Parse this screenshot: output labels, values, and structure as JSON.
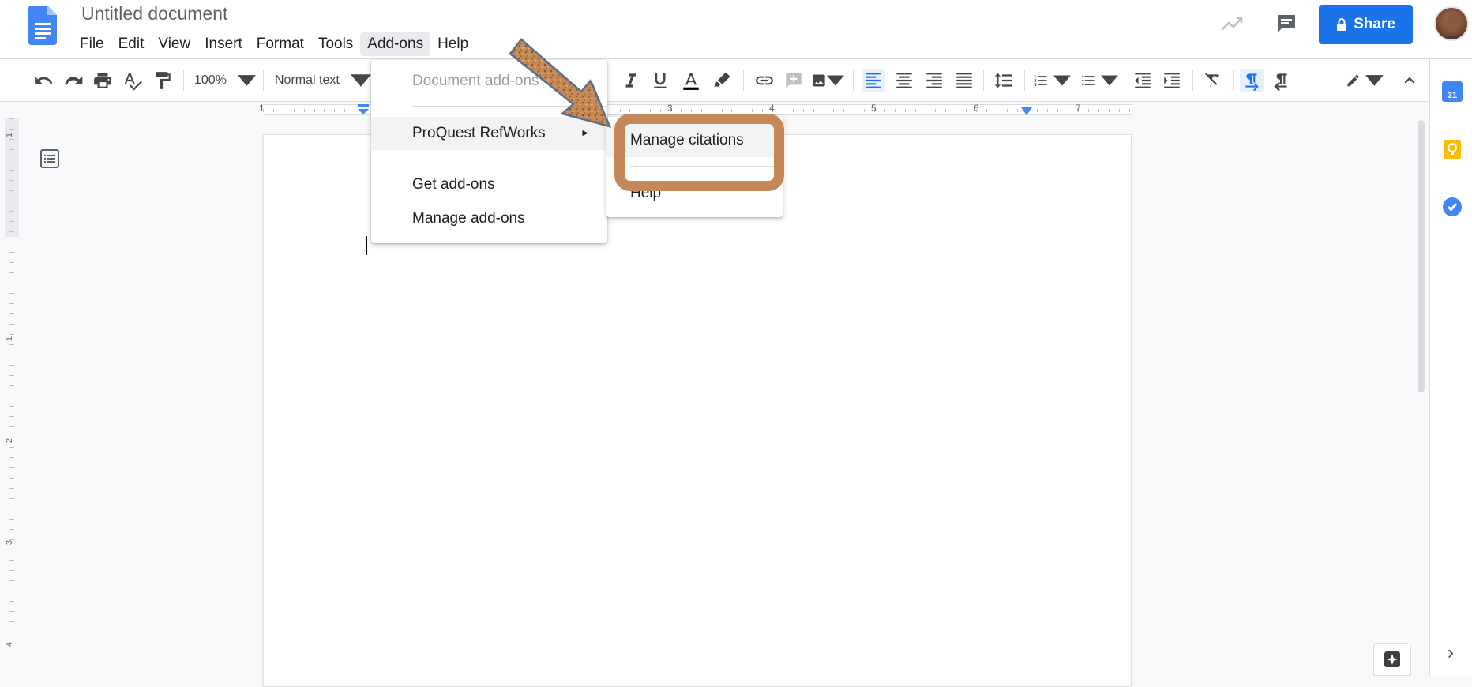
{
  "header": {
    "title": "Untitled document",
    "menus": [
      "File",
      "Edit",
      "View",
      "Insert",
      "Format",
      "Tools",
      "Add-ons",
      "Help"
    ],
    "active_menu": "Add-ons",
    "share_label": "Share",
    "brand_color": "#1a73e8"
  },
  "toolbar": {
    "zoom": "100%",
    "style": "Normal text",
    "icons": [
      "undo-icon",
      "redo-icon",
      "print-icon",
      "spellcheck-icon",
      "paint-format-icon",
      "italic-icon",
      "underline-icon",
      "text-color-icon",
      "highlight-icon",
      "link-icon",
      "comment-icon",
      "image-icon",
      "align-left-icon",
      "align-center-icon",
      "align-right-icon",
      "justify-icon",
      "line-spacing-icon",
      "numbered-list-icon",
      "bulleted-list-icon",
      "decrease-indent-icon",
      "increase-indent-icon",
      "clear-formatting-icon",
      "ltr-icon",
      "rtl-icon",
      "editing-mode-icon",
      "collapse-icon"
    ]
  },
  "ruler": {
    "numbers": [
      "1",
      "3",
      "4",
      "5",
      "6",
      "7"
    ]
  },
  "vertical_ruler": {
    "numbers": [
      "1",
      "1",
      "2",
      "3",
      "4"
    ]
  },
  "addons_menu": {
    "items": [
      {
        "label": "Document add-ons",
        "disabled": true
      },
      {
        "label": "ProQuest RefWorks",
        "has_submenu": true,
        "highlighted": true
      },
      {
        "label": "Get add-ons"
      },
      {
        "label": "Manage add-ons"
      }
    ],
    "submenu_arrow": "►"
  },
  "refworks_menu": {
    "items": [
      {
        "label": "Manage citations"
      },
      {
        "label": "Help"
      }
    ]
  },
  "side_panel": {
    "calendar_day": "31",
    "icons": [
      "calendar-icon",
      "keep-icon",
      "tasks-icon"
    ],
    "expand": "›"
  },
  "annotation": {
    "highlight_color": "#c4895a",
    "arrow_texture": "cork"
  }
}
